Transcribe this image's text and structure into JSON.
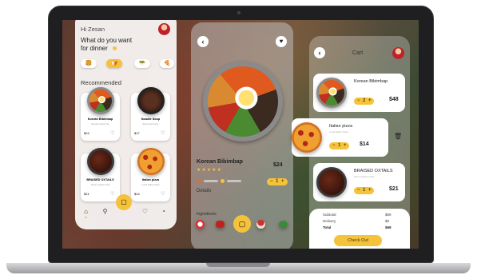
{
  "home": {
    "greeting": "Hi Zesan",
    "prompt_line1": "What do you want",
    "prompt_line2": "for dinner",
    "section_title": "Recommended",
    "categories": [
      "🍔",
      "🍞",
      "🥗",
      "🍕"
    ],
    "items": [
      {
        "name": "Korean Bibimbap",
        "sub": "Special mixed rice",
        "price": "$24"
      },
      {
        "name": "Noodle Soup",
        "sub": "Spicy beef soup",
        "price": "$17"
      },
      {
        "name": "BRAISED OXTAILS",
        "sub": "Slow cooked oxtail",
        "price": "$21"
      },
      {
        "name": "Italian pizza",
        "sub": "Local Italian Taste",
        "price": "$14"
      }
    ],
    "nav_icons": [
      "home-icon",
      "search-icon",
      "bag-icon",
      "heart-icon",
      "bell-icon"
    ]
  },
  "detail": {
    "title": "Korean Bibimbap",
    "price": "$24",
    "rating": "★★★★★",
    "section_details": "Details",
    "section_ingredients": "Ingredients",
    "stepper": {
      "minus": "−",
      "qty": "1",
      "plus": "+"
    }
  },
  "cart": {
    "title": "Cart",
    "items": [
      {
        "name": "Korean Bibimbap",
        "qty": "2",
        "price": "$48"
      },
      {
        "name": "Italian pizza",
        "sub": "Local Italian Taste",
        "qty": "1",
        "price": "$14"
      },
      {
        "name": "BRAISED OXTAILS",
        "sub": "Slow cooked oxtail",
        "qty": "1",
        "price": "$21"
      }
    ],
    "summary": [
      {
        "label": "Subtotal",
        "value": "$69"
      },
      {
        "label": "Delivery",
        "value": "$0"
      },
      {
        "label": "Total",
        "value": "$69"
      }
    ],
    "checkout_label": "Check Out",
    "minus": "−",
    "plus": "+"
  },
  "colors": {
    "accent": "#f5c33b"
  }
}
